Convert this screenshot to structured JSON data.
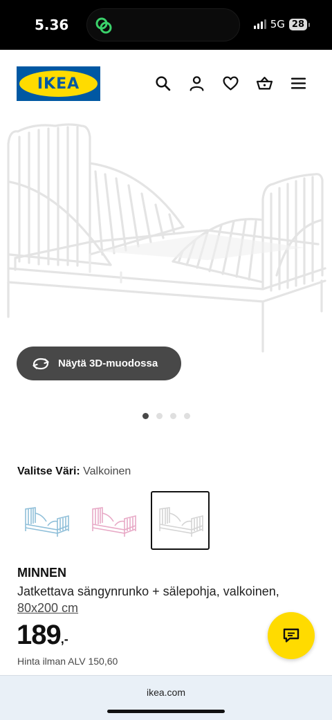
{
  "status_bar": {
    "time": "5.36",
    "network": "5G",
    "battery": "28"
  },
  "header": {
    "logo_text": "IKEA",
    "icons": [
      "search-icon",
      "user-icon",
      "heart-icon",
      "basket-icon",
      "menu-icon"
    ]
  },
  "gallery": {
    "view_3d_label": "Näytä 3D-muodossa",
    "image_count": 4,
    "active_index": 0
  },
  "color_picker": {
    "label": "Valitse Väri:",
    "selected": "Valkoinen",
    "options": [
      {
        "name": "blue",
        "color": "#8fbfd9"
      },
      {
        "name": "pink",
        "color": "#e8a9c6"
      },
      {
        "name": "white",
        "color": "#dcdcdc"
      }
    ]
  },
  "product": {
    "name": "MINNEN",
    "description": "Jatkettava sängynrunko + sälepohja, valkoinen,",
    "size": "80x200 cm",
    "price": "189",
    "price_suffix": ",-",
    "vat_text": "Hinta ilman ALV 150,60"
  },
  "browser": {
    "url": "ikea.com"
  },
  "colors": {
    "brand_blue": "#0058a3",
    "brand_yellow": "#ffdb00",
    "dark_button": "#484848"
  }
}
